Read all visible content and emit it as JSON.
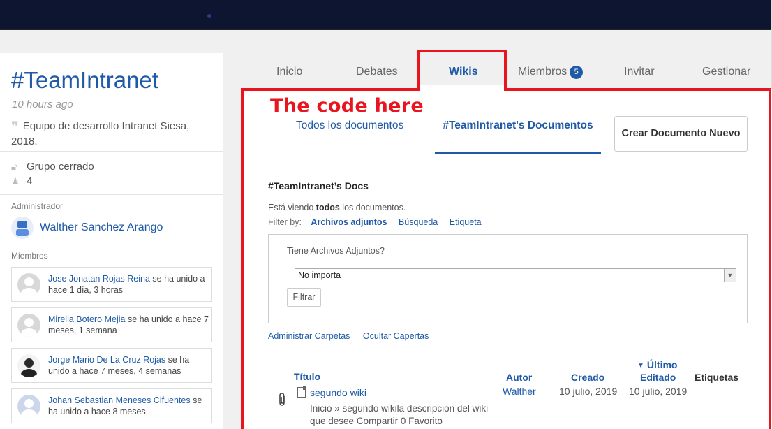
{
  "group": {
    "title": "#TeamIntranet",
    "time": "10 hours ago",
    "description": "Equipo de desarrollo Intranet Siesa, 2018.",
    "privacy": "Grupo cerrado",
    "member_count": "4"
  },
  "sidebar": {
    "admin_label": "Administrador",
    "admin_name": "Walther Sanchez Arango",
    "members_label": "Miembros",
    "members": [
      {
        "name": "Jose Jonatan Rojas Reina",
        "action": " se ha unido a hace 1 día, 3 horas"
      },
      {
        "name": "Mirella Botero Mejia",
        "action": " se ha unido a hace 7 meses, 1 semana"
      },
      {
        "name": "Jorge Mario De La Cruz Rojas",
        "action": " se ha unido a hace 7 meses, 4 semanas"
      },
      {
        "name": "Johan Sebastian Meneses Cifuentes",
        "action": " se ha unido a hace 8 meses"
      }
    ]
  },
  "tabs": {
    "inicio": "Inicio",
    "debates": "Debates",
    "wikis": "Wikis",
    "miembros": "Miembros",
    "miembros_badge": "5",
    "invitar": "Invitar",
    "gestionar": "Gestionar"
  },
  "annotation": {
    "text": "The code here",
    "color": "#e8141e"
  },
  "docs": {
    "subnav_all": "Todos los documentos",
    "subnav_group": "#TeamIntranet's Documentos",
    "new_button": "Crear Documento Nuevo",
    "heading": "#TeamIntranet’s Docs",
    "viewing_prefix": "Está viendo ",
    "viewing_bold": "todos",
    "viewing_suffix": " los documentos.",
    "filter_by_label": "Filter by:",
    "filter_options": [
      "Archivos adjuntos",
      "Búsqueda",
      "Etiqueta"
    ],
    "filter_question": "Tiene Archivos Adjuntos?",
    "filter_selected": "No importa",
    "filter_button": "Filtrar",
    "manage_folders": "Administrar Carpetas",
    "hide_folders": "Ocultar Capertas"
  },
  "table": {
    "headers": {
      "title": "Título",
      "author": "Autor",
      "created": "Creado",
      "edited_line1": "Último",
      "edited_line2": "Editado",
      "tags": "Etiquetas"
    },
    "rows": [
      {
        "title": "segundo wiki",
        "snippet": "Inicio » segundo wikila descripcion del wiki que desee Compartir 0 Favorito",
        "author": "Walther",
        "created": "10 julio, 2019",
        "edited": "10 julio, 2019"
      }
    ]
  },
  "colors": {
    "brand_blue": "#1f5aa6",
    "banner": "#0e1530"
  }
}
